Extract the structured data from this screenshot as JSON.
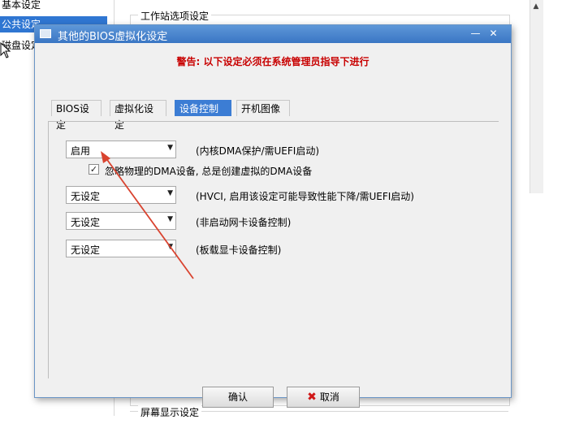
{
  "background": {
    "sidebar": {
      "items": [
        {
          "label": "基本设定"
        },
        {
          "label": "公共设定"
        },
        {
          "label": "磁盘设定"
        }
      ]
    },
    "group_workstation_label": "工作站选项设定",
    "group_display_label": "屏幕显示设定"
  },
  "dialog": {
    "title": "其他的BIOS虚拟化设定",
    "warning": "警告: 以下设定必须在系统管理员指导下进行",
    "tabs": [
      {
        "label": "BIOS设定",
        "active": false
      },
      {
        "label": "虚拟化设定",
        "active": false
      },
      {
        "label": "设备控制",
        "active": true
      },
      {
        "label": "开机图像",
        "active": false
      }
    ],
    "settings": [
      {
        "value": "启用",
        "desc": "(内核DMA保护/需UEFI启动)"
      },
      {
        "value": "无设定",
        "desc": "(HVCI, 启用该设定可能导致性能下降/需UEFI启动)"
      },
      {
        "value": "无设定",
        "desc": "(非启动网卡设备控制)"
      },
      {
        "value": "无设定",
        "desc": "(板载显卡设备控制)"
      }
    ],
    "checkbox": {
      "label": "忽略物理的DMA设备, 总是创建虚拟的DMA设备",
      "checked": true,
      "mark": "✓"
    },
    "ok_label": "确认",
    "cancel_label": "取消",
    "cancel_icon": "✖"
  },
  "colors": {
    "accent": "#3c7dd4",
    "warning": "#c80000",
    "annotation_arrow": "#d9432f"
  }
}
